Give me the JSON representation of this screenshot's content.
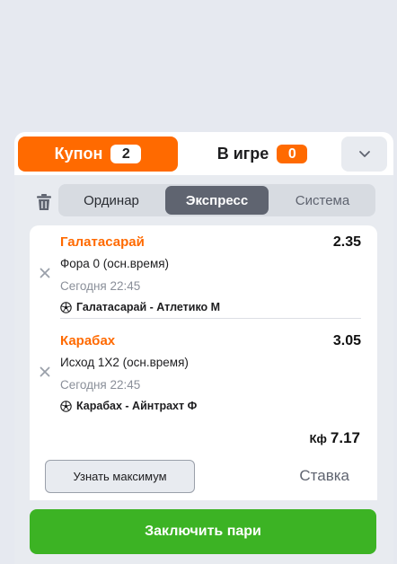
{
  "tabs": {
    "coupon": {
      "label": "Купон",
      "count": "2"
    },
    "in_game": {
      "label": "В игре",
      "count": "0"
    }
  },
  "bet_types": {
    "single": "Ординар",
    "express": "Экспресс",
    "system": "Система",
    "selected": "Экспресс"
  },
  "bets": [
    {
      "team": "Галатасарай",
      "odd": "2.35",
      "market": "Фора 0 (осн.время)",
      "time": "Сегодня 22:45",
      "match": "Галатасарай - Атлетико М",
      "sport_icon": "soccer-ball-icon"
    },
    {
      "team": "Карабах",
      "odd": "3.05",
      "market": "Исход 1Х2 (осн.время)",
      "time": "Сегодня 22:45",
      "match": "Карабах - Айнтрахт Ф",
      "sport_icon": "soccer-ball-icon"
    }
  ],
  "summary": {
    "kf_label": "Кф",
    "total_odds": "7.17",
    "max_label": "Узнать максимум",
    "stake_placeholder": "Ставка"
  },
  "place_bet_label": "Заключить пари",
  "colors": {
    "accent": "#ff6a00",
    "success": "#3cb324",
    "panel_bg": "#e8ebf0",
    "page_bg": "#e6e9f0"
  }
}
